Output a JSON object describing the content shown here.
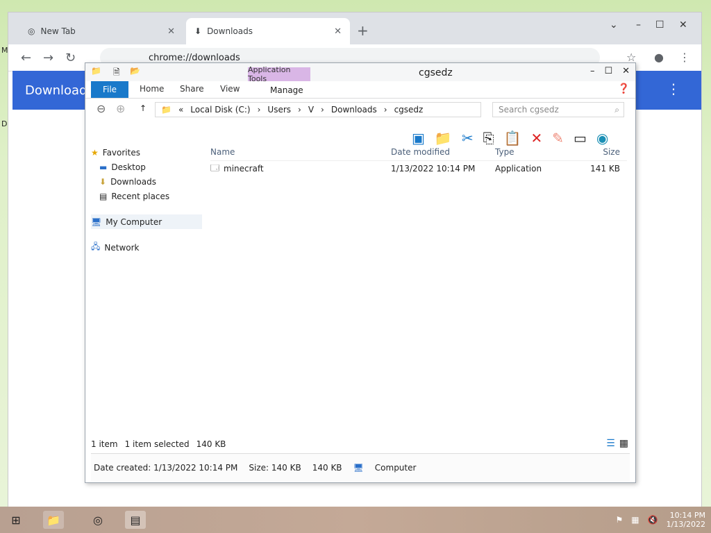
{
  "desktop": {
    "left_letters": [
      "M",
      "D"
    ]
  },
  "chrome": {
    "tabs": [
      {
        "label": "New Tab"
      },
      {
        "label": "Downloads"
      }
    ],
    "new_tab_icon": "plus-icon",
    "window_controls": [
      "⌄",
      "–",
      "☐",
      "✕"
    ],
    "url": "chrome://downloads",
    "page_title": "Downloads",
    "accent": "#3367d6"
  },
  "explorer": {
    "title": "cgsedz",
    "context_tab": "Application Tools",
    "ribbon_tabs": [
      "File",
      "Home",
      "Share",
      "View"
    ],
    "manage_label": "Manage",
    "address": {
      "prefix": "«",
      "parts": [
        "Local Disk (C:)",
        "Users",
        "V",
        "Downloads",
        "cgsedz"
      ]
    },
    "search_placeholder": "Search cgsedz",
    "nav": {
      "favorites": "Favorites",
      "fav_items": [
        "Desktop",
        "Downloads",
        "Recent places"
      ],
      "computer": "My Computer",
      "network": "Network"
    },
    "columns": {
      "name": "Name",
      "date": "Date modified",
      "type": "Type",
      "size": "Size"
    },
    "files": [
      {
        "name": "minecraft",
        "date": "1/13/2022 10:14 PM",
        "type": "Application",
        "size": "141 KB"
      }
    ],
    "status": {
      "items": "1 item",
      "selected": "1 item selected",
      "sel_size": "140 KB"
    },
    "details": {
      "date_created": "Date created: 1/13/2022 10:14 PM",
      "size": "Size: 140 KB",
      "size_short": "140 KB",
      "location": "Computer"
    }
  },
  "taskbar": {
    "clock_time": "10:14 PM",
    "clock_date": "1/13/2022"
  }
}
